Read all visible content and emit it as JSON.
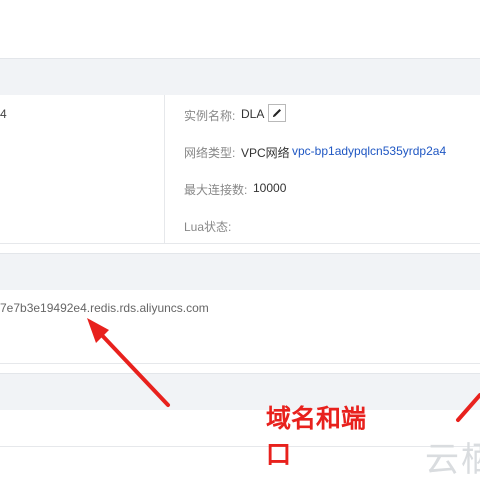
{
  "info_rows": [
    {
      "left_value": "4",
      "label": "实例名称:",
      "value": "DLA"
    },
    {
      "left_value": "",
      "label": "网络类型:",
      "value": "VPC网络",
      "link": "vpc-bp1adypqlcn535yrdp2a4"
    },
    {
      "left_value": "",
      "label": "最大连接数:",
      "value": "10000"
    },
    {
      "left_value": "",
      "label": "Lua状态:",
      "value": ""
    }
  ],
  "connection": {
    "host": "7e7b3e19492e4.redis.rds.aliyuncs.com"
  },
  "annotation": {
    "line1": "域名和端",
    "line2": "口",
    "color": "#e8211d"
  },
  "watermark": "云栖",
  "icons": {
    "edit": "pencil-icon",
    "arrow": "red-arrow"
  }
}
